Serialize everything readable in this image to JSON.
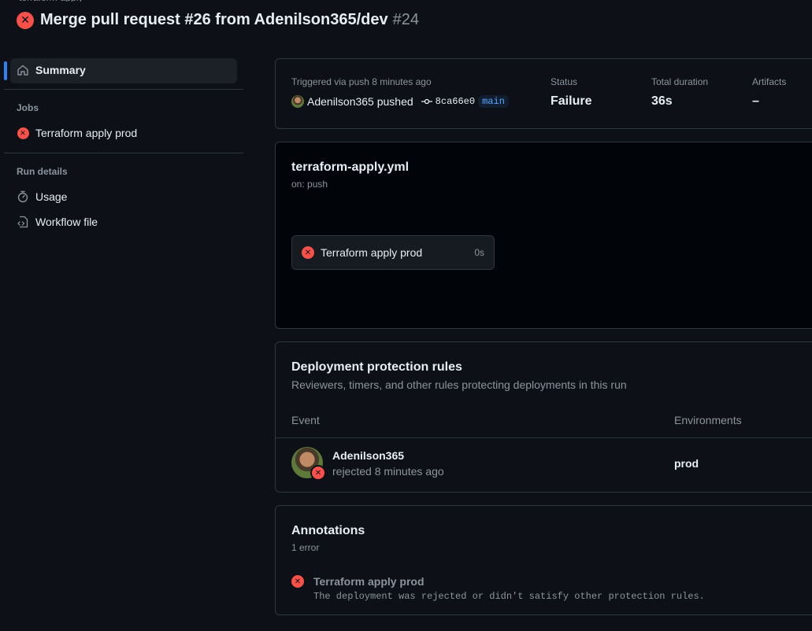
{
  "header": {
    "title": "Merge pull request #26 from Adenilson365/dev",
    "run_number": "#24",
    "breadcrumb_peek": "terraform-apply"
  },
  "sidebar": {
    "summary_label": "Summary",
    "jobs_heading": "Jobs",
    "jobs": [
      {
        "label": "Terraform apply prod",
        "status": "failure"
      }
    ],
    "run_details_heading": "Run details",
    "run_details": [
      {
        "label": "Usage",
        "icon": "stopwatch-icon"
      },
      {
        "label": "Workflow file",
        "icon": "file-code-icon"
      }
    ]
  },
  "summary_card": {
    "triggered": "Triggered via push 8 minutes ago",
    "actor": "Adenilson365 pushed",
    "commit": "8ca66e0",
    "branch": "main",
    "status_label": "Status",
    "status_value": "Failure",
    "duration_label": "Total duration",
    "duration_value": "36s",
    "artifacts_label": "Artifacts",
    "artifacts_value": "–"
  },
  "workflow_card": {
    "file": "terraform-apply.yml",
    "trigger": "on: push",
    "job": {
      "name": "Terraform apply prod",
      "duration": "0s"
    }
  },
  "deployment_card": {
    "title": "Deployment protection rules",
    "subtitle": "Reviewers, timers, and other rules protecting deployments in this run",
    "col_event": "Event",
    "col_env": "Environments",
    "rows": [
      {
        "user": "Adenilson365",
        "action": "rejected 8 minutes ago",
        "env": "prod"
      }
    ]
  },
  "annotations_card": {
    "title": "Annotations",
    "count": "1 error",
    "items": [
      {
        "title": "Terraform apply prod",
        "message": "The deployment was rejected or didn't satisfy other protection rules."
      }
    ]
  },
  "colors": {
    "background": "#0d1117",
    "failure": "#f85149",
    "accent": "#2f81f7",
    "border": "#30363d"
  }
}
